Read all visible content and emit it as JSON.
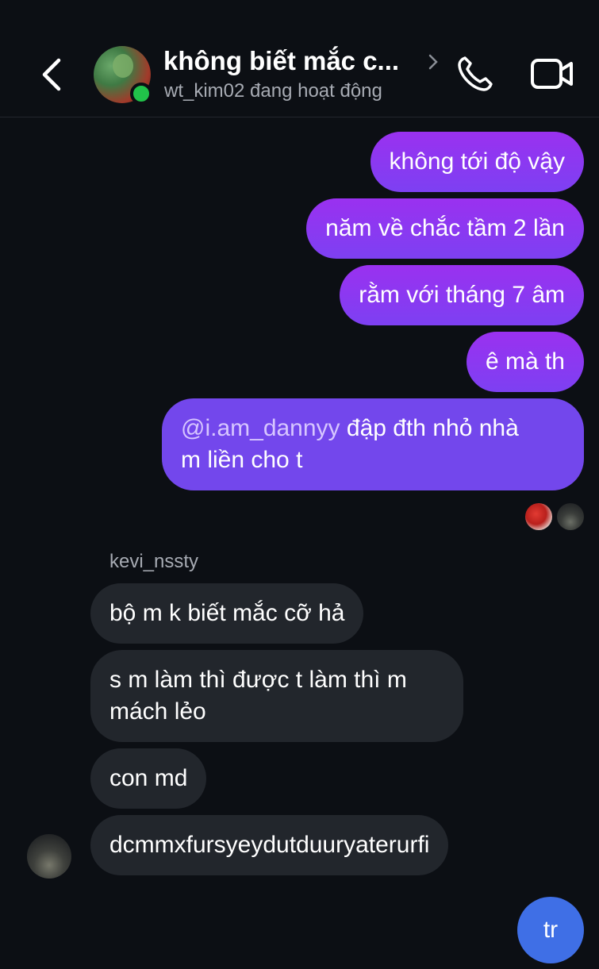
{
  "header": {
    "title": "không biết mắc c...",
    "status": "wt_kim02 đang hoạt động",
    "colors": {
      "online": "#21c34a"
    }
  },
  "messages_out": [
    "không tới độ vậy",
    "năm về chắc tầm 2 lần",
    "rằm với tháng 7 âm",
    "ê mà th"
  ],
  "message_mention": {
    "mention": "@i.am_dannyy",
    "line1_rest": " đập đth nhỏ nhà",
    "line2": "m liền cho t"
  },
  "sender": "kevi_nssty",
  "messages_in": [
    {
      "lines": [
        "bộ m k biết mắc cỡ hả"
      ]
    },
    {
      "lines": [
        "s m làm thì được t làm thì m",
        "mách lẻo"
      ]
    },
    {
      "lines": [
        "con md"
      ]
    },
    {
      "lines": [
        "dcmmxfursyeydutduuryaterurfi"
      ]
    }
  ],
  "compose": {
    "label": "tr"
  },
  "icons": [
    "back-icon",
    "chevron-right-icon",
    "phone-icon",
    "video-camera-icon"
  ]
}
